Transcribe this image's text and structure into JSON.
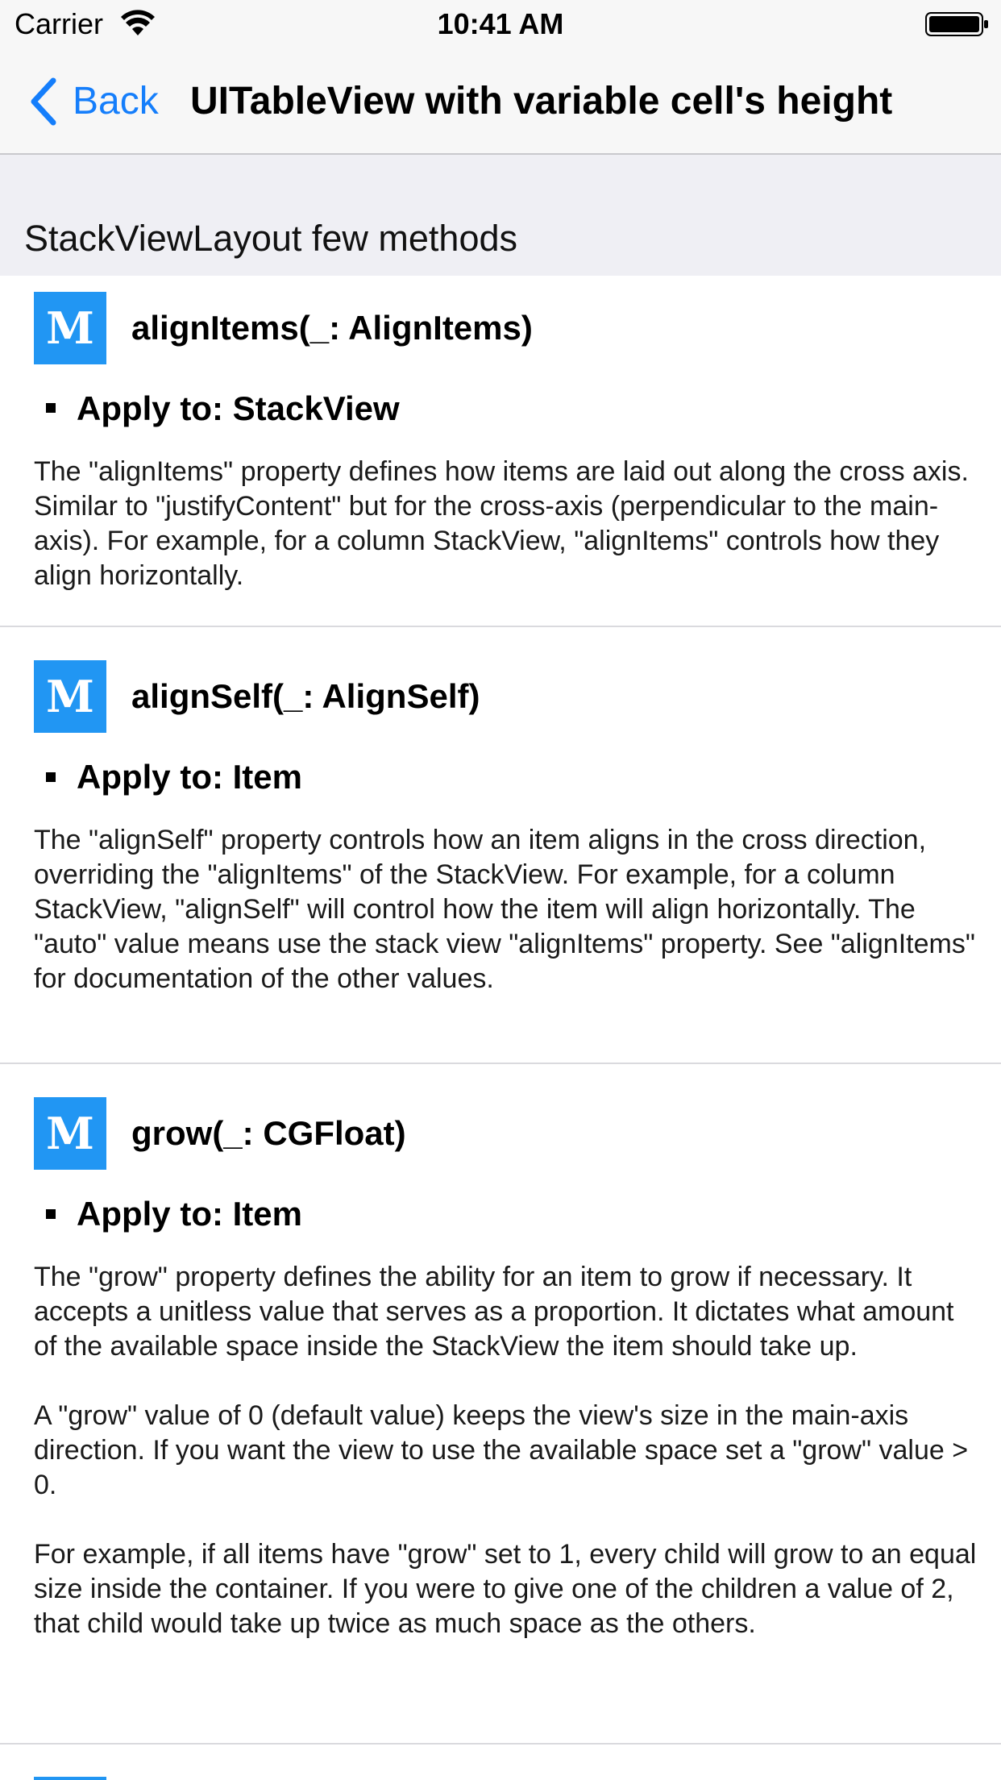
{
  "status_bar": {
    "carrier": "Carrier",
    "time": "10:41 AM"
  },
  "nav": {
    "back_label": "Back",
    "title": "UITableView with variable cell's height"
  },
  "section": {
    "header": "StackViewLayout few methods"
  },
  "cells": [
    {
      "icon_letter": "M",
      "method": "alignItems(_: AlignItems)",
      "apply_to": "Apply to: StackView",
      "paragraphs": [
        "The \"alignItems\" property defines how items are laid out along the cross axis. Similar to \"justifyContent\" but for the cross-axis (perpendicular to the main-axis). For example, for a column StackView, \"alignItems\" controls how they align horizontally."
      ]
    },
    {
      "icon_letter": "M",
      "method": "alignSelf(_: AlignSelf)",
      "apply_to": "Apply to: Item",
      "paragraphs": [
        "The \"alignSelf\" property controls how an item aligns in the cross direction, overriding the \"alignItems\" of the StackView. For example, for a column StackView, \"alignSelf\" will control how the item will align horizontally. The \"auto\" value means use the stack view \"alignItems\" property. See \"alignItems\" for documentation of the other values."
      ]
    },
    {
      "icon_letter": "M",
      "method": "grow(_: CGFloat)",
      "apply_to": "Apply to: Item",
      "paragraphs": [
        "The \"grow\" property defines the ability for an item to grow if necessary. It accepts a unitless value that serves as a proportion. It dictates what amount of the available space inside the StackView the item should take up.",
        "A \"grow\" value of 0 (default value) keeps the view's size in the main-axis direction. If you want the view to use the available space set a \"grow\" value > 0.",
        "For example, if all items have \"grow\" set to 1, every child will grow to an equal size inside the container. If you were to give one of the children a value of 2, that child would take up twice as much space as the others."
      ]
    }
  ],
  "colors": {
    "accent": "#157efb",
    "icon_bg": "#2196f3",
    "nav_bg": "#f7f7f7",
    "section_bg": "#efeff4"
  }
}
